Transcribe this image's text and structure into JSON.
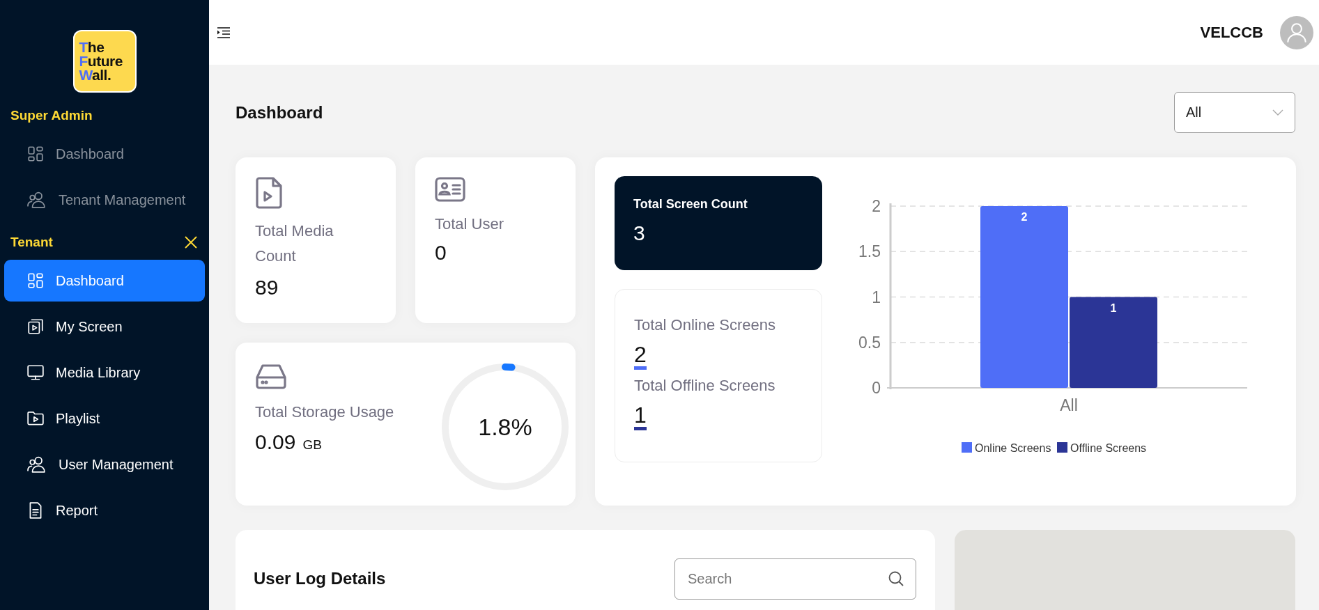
{
  "logo": {
    "lines": [
      {
        "initial": "T",
        "rest": "he"
      },
      {
        "initial": "F",
        "rest": "uture"
      },
      {
        "initial": "W",
        "rest": "all."
      }
    ]
  },
  "sidebar": {
    "sections": [
      {
        "title": "Super Admin",
        "closable": false,
        "items": [
          {
            "label": "Dashboard",
            "selected": false,
            "disabled": true
          },
          {
            "label": "Tenant Management",
            "selected": false,
            "disabled": true
          }
        ]
      },
      {
        "title": "Tenant",
        "closable": true,
        "items": [
          {
            "label": "Dashboard",
            "selected": true,
            "disabled": false
          },
          {
            "label": "My Screen",
            "selected": false,
            "disabled": false
          },
          {
            "label": "Media Library",
            "selected": false,
            "disabled": false
          },
          {
            "label": "Playlist",
            "selected": false,
            "disabled": false
          },
          {
            "label": "User Management",
            "selected": false,
            "disabled": false
          },
          {
            "label": "Report",
            "selected": false,
            "disabled": false
          }
        ]
      }
    ]
  },
  "header": {
    "username": "VELCCB"
  },
  "page": {
    "title": "Dashboard",
    "filter": {
      "value": "All"
    }
  },
  "cards": {
    "media": {
      "label": "Total Media Count",
      "value": "89"
    },
    "users": {
      "label": "Total User",
      "value": "0"
    },
    "storage": {
      "label": "Total Storage Usage",
      "value": "0.09",
      "unit": "GB",
      "percent": "1.8%",
      "level": 0.018
    }
  },
  "screens": {
    "total": {
      "label": "Total Screen Count",
      "value": "3"
    },
    "stats": [
      {
        "label": "Total Online Screens",
        "value": "2",
        "color": "#4f6ef7"
      },
      {
        "label": "Total Offline Screens",
        "value": "1",
        "color": "#2b3596"
      }
    ],
    "chart_data": {
      "type": "bar",
      "categories": [
        "All"
      ],
      "series": [
        {
          "name": "Online Screens",
          "color": "#4f6ef7",
          "values": [
            2
          ]
        },
        {
          "name": "Offline Screens",
          "color": "#2b3596",
          "values": [
            1
          ]
        }
      ],
      "ylim": [
        0,
        2
      ],
      "yticks": [
        {
          "value": 0,
          "label": "0"
        },
        {
          "value": 0.5,
          "label": "0.5"
        },
        {
          "value": 1,
          "label": "1"
        },
        {
          "value": 1.5,
          "label": "1.5"
        },
        {
          "value": 2,
          "label": "2"
        }
      ],
      "value_labels": [
        [
          "2"
        ],
        [
          "1"
        ]
      ],
      "grid": true,
      "legend": true
    }
  },
  "user_log": {
    "title": "User Log Details",
    "search": {
      "placeholder": "Search"
    }
  }
}
